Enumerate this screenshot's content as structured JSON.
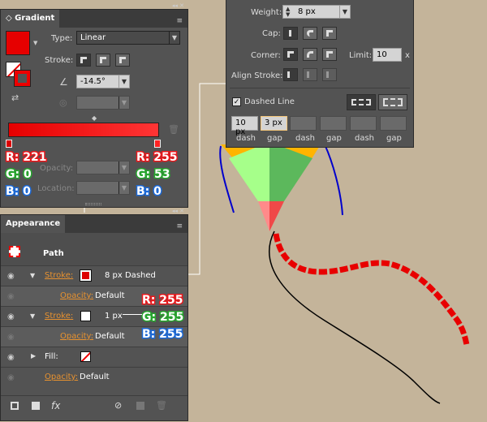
{
  "gradient_panel": {
    "title": "Gradient",
    "type_label": "Type:",
    "type_value": "Linear",
    "stroke_label": "Stroke:",
    "angle_value": "-14.5°",
    "opacity_label": "Opacity:",
    "location_label": "Location:",
    "gradient_start": "#e60000",
    "gradient_end": "#ff3535",
    "stop_left": {
      "r": "R: 221",
      "g": "G: 0",
      "b": "B: 0"
    },
    "stop_right": {
      "r": "R: 255",
      "g": "G: 53",
      "b": "B: 0"
    }
  },
  "appearance_panel": {
    "title": "Appearance",
    "path_label": "Path",
    "rows": [
      {
        "label": "Stroke:",
        "value": "8 px Dashed",
        "swatch": "#dd0000"
      },
      {
        "label": "Opacity:",
        "value": "Default"
      },
      {
        "label": "Stroke:",
        "value": "1 px",
        "swatch": "#ffffff"
      },
      {
        "label": "Opacity:",
        "value": "Default"
      },
      {
        "label": "Fill:",
        "value": ""
      },
      {
        "label": "Opacity:",
        "value": "Default"
      }
    ],
    "fx_label": "fx",
    "stroke2_rgb": {
      "r": "R: 255",
      "g": "G: 255",
      "b": "B: 255"
    }
  },
  "stroke_panel": {
    "weight_label": "Weight:",
    "weight_value": "8 px",
    "cap_label": "Cap:",
    "corner_label": "Corner:",
    "limit_label": "Limit:",
    "limit_value": "10",
    "limit_unit": "x",
    "align_label": "Align Stroke:",
    "dashed_label": "Dashed Line",
    "dash_values": [
      "10 px",
      "3 px",
      "",
      "",
      "",
      ""
    ],
    "dash_labels": [
      "dash",
      "gap",
      "dash",
      "gap",
      "dash",
      "gap"
    ]
  },
  "colors": {
    "kite_orange": "#ffb400",
    "kite_light_green": "#a6ff8a",
    "kite_green": "#5cb85c",
    "kite_pink": "#ff7a7a",
    "kite_red": "#f04848",
    "tail_dashed": "#e80000",
    "string_blue": "#0000cc"
  }
}
